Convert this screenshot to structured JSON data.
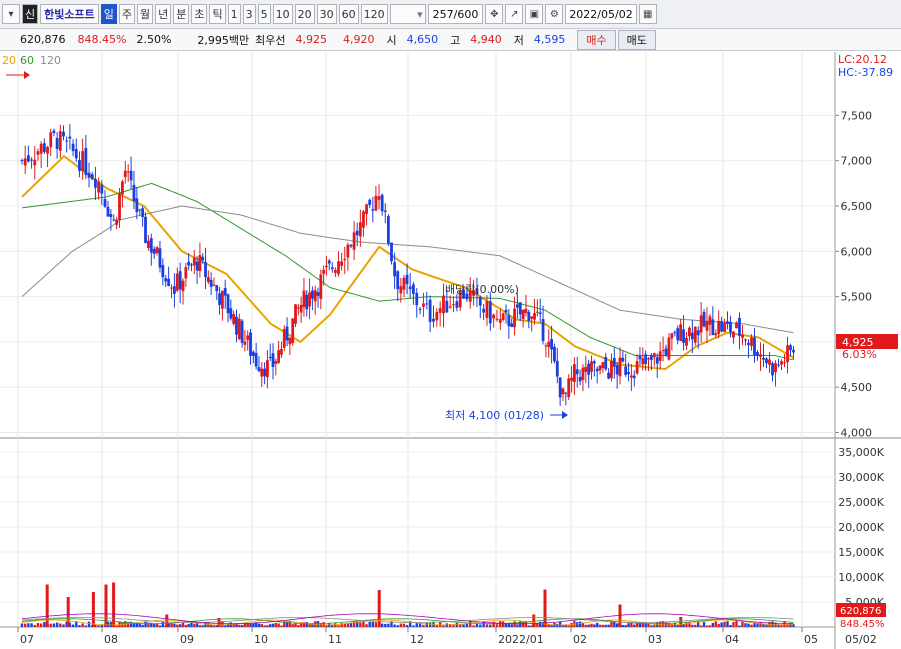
{
  "toolbar": {
    "market_badge": "신",
    "stock_name": "한빛소프트",
    "periods": [
      "일",
      "주",
      "월",
      "년",
      "분",
      "초",
      "틱"
    ],
    "active_period": "일",
    "intervals": [
      "1",
      "3",
      "5",
      "10",
      "20",
      "30",
      "60",
      "120"
    ],
    "count": "257",
    "count_max": "/600",
    "date": "2022/05/02"
  },
  "quote": {
    "price": "620,876",
    "change_pct": "848.45%",
    "rate": "2.50%",
    "amount": "2,995백만",
    "best_ask_label": "최우선",
    "best_ask": "4,925",
    "best_bid": "4,920",
    "open_label": "시",
    "open": "4,650",
    "high_label": "고",
    "high": "4,940",
    "low_label": "저",
    "low": "4,595",
    "buy_label": "매수",
    "sell_label": "매도"
  },
  "chart_labels": {
    "ma_legend": [
      "20",
      "60",
      "120"
    ],
    "lc": "LC:20.12",
    "hc": "HC:-37.89",
    "current_price": "4,925",
    "current_pct": "6.03%",
    "volume_current": "620,876",
    "volume_pct": "848.45%",
    "low_annotation": "최저 4,100 (01/28)",
    "dividend_annotation": "배당락(0.00%)",
    "price_ticks": [
      "7,500",
      "7,000",
      "6,500",
      "6,000",
      "5,500",
      "5,000",
      "4,500",
      "4,000"
    ],
    "volume_ticks": [
      "35,000K",
      "30,000K",
      "25,000K",
      "20,000K",
      "15,000K",
      "10,000K",
      "5,000K"
    ],
    "x_ticks": [
      "07",
      "08",
      "09",
      "10",
      "11",
      "12",
      "2022/01",
      "02",
      "03",
      "04",
      "05",
      "05/02"
    ]
  },
  "chart_data": {
    "type": "line",
    "price_axis": {
      "min": 3950,
      "max": 8200,
      "ticks": [
        4000,
        4500,
        5000,
        5500,
        6000,
        6500,
        7000,
        7500
      ]
    },
    "volume_axis": {
      "min": 0,
      "max": 37000,
      "unit": "K",
      "ticks": [
        5000,
        10000,
        15000,
        20000,
        25000,
        30000,
        35000
      ]
    },
    "months": [
      "07",
      "08",
      "09",
      "10",
      "11",
      "12",
      "2022/01",
      "02",
      "03",
      "04",
      "05"
    ],
    "close_path": [
      {
        "x": 0,
        "y": 7000
      },
      {
        "x": 0.4,
        "y": 7250
      },
      {
        "x": 0.6,
        "y": 7100
      },
      {
        "x": 0.9,
        "y": 6800
      },
      {
        "x": 1.1,
        "y": 6300
      },
      {
        "x": 1.25,
        "y": 6900
      },
      {
        "x": 1.5,
        "y": 6200
      },
      {
        "x": 1.9,
        "y": 5600
      },
      {
        "x": 2.2,
        "y": 5900
      },
      {
        "x": 2.6,
        "y": 5400
      },
      {
        "x": 3.0,
        "y": 4800
      },
      {
        "x": 3.2,
        "y": 4700
      },
      {
        "x": 3.6,
        "y": 5400
      },
      {
        "x": 4.0,
        "y": 5800
      },
      {
        "x": 4.4,
        "y": 6300
      },
      {
        "x": 4.6,
        "y": 6700
      },
      {
        "x": 4.8,
        "y": 5700
      },
      {
        "x": 5.2,
        "y": 5300
      },
      {
        "x": 5.6,
        "y": 5550
      },
      {
        "x": 6.0,
        "y": 5200
      },
      {
        "x": 6.4,
        "y": 5350
      },
      {
        "x": 6.6,
        "y": 5100
      },
      {
        "x": 6.85,
        "y": 4350
      },
      {
        "x": 7.0,
        "y": 4650
      },
      {
        "x": 7.5,
        "y": 4700
      },
      {
        "x": 8.0,
        "y": 4750
      },
      {
        "x": 8.4,
        "y": 5100
      },
      {
        "x": 8.8,
        "y": 5200
      },
      {
        "x": 9.2,
        "y": 5100
      },
      {
        "x": 9.6,
        "y": 4700
      },
      {
        "x": 9.85,
        "y": 4925
      }
    ],
    "series": [
      {
        "name": "20",
        "color": "#e8a300",
        "points": [
          {
            "x": 0,
            "y": 6600
          },
          {
            "x": 0.5,
            "y": 7050
          },
          {
            "x": 1.0,
            "y": 6700
          },
          {
            "x": 1.5,
            "y": 6500
          },
          {
            "x": 2.0,
            "y": 6000
          },
          {
            "x": 2.6,
            "y": 5750
          },
          {
            "x": 3.2,
            "y": 5200
          },
          {
            "x": 3.6,
            "y": 5000
          },
          {
            "x": 4.0,
            "y": 5300
          },
          {
            "x": 4.6,
            "y": 6050
          },
          {
            "x": 5.0,
            "y": 5800
          },
          {
            "x": 5.6,
            "y": 5600
          },
          {
            "x": 6.2,
            "y": 5250
          },
          {
            "x": 6.6,
            "y": 5200
          },
          {
            "x": 7.0,
            "y": 4950
          },
          {
            "x": 7.6,
            "y": 4750
          },
          {
            "x": 8.2,
            "y": 4700
          },
          {
            "x": 8.6,
            "y": 4950
          },
          {
            "x": 9.0,
            "y": 5100
          },
          {
            "x": 9.4,
            "y": 5050
          },
          {
            "x": 9.85,
            "y": 4820
          }
        ]
      },
      {
        "name": "60",
        "color": "#2e9a2e",
        "points": [
          {
            "x": 0,
            "y": 6480
          },
          {
            "x": 1.0,
            "y": 6600
          },
          {
            "x": 1.6,
            "y": 6750
          },
          {
            "x": 2.2,
            "y": 6550
          },
          {
            "x": 2.8,
            "y": 6250
          },
          {
            "x": 3.4,
            "y": 5950
          },
          {
            "x": 4.0,
            "y": 5600
          },
          {
            "x": 4.6,
            "y": 5450
          },
          {
            "x": 5.2,
            "y": 5500
          },
          {
            "x": 6.0,
            "y": 5480
          },
          {
            "x": 6.6,
            "y": 5350
          },
          {
            "x": 7.2,
            "y": 5050
          },
          {
            "x": 7.8,
            "y": 4850
          },
          {
            "x": 8.4,
            "y": 4850
          },
          {
            "x": 9.0,
            "y": 4850
          },
          {
            "x": 9.6,
            "y": 4850
          },
          {
            "x": 9.85,
            "y": 4800
          }
        ]
      },
      {
        "name": "120",
        "color": "#8b8b8b",
        "points": [
          {
            "x": 0,
            "y": 5500
          },
          {
            "x": 0.6,
            "y": 6000
          },
          {
            "x": 1.2,
            "y": 6350
          },
          {
            "x": 2.0,
            "y": 6500
          },
          {
            "x": 2.8,
            "y": 6400
          },
          {
            "x": 3.6,
            "y": 6200
          },
          {
            "x": 4.4,
            "y": 6100
          },
          {
            "x": 5.2,
            "y": 6050
          },
          {
            "x": 6.0,
            "y": 5950
          },
          {
            "x": 6.8,
            "y": 5650
          },
          {
            "x": 7.6,
            "y": 5350
          },
          {
            "x": 8.4,
            "y": 5250
          },
          {
            "x": 9.2,
            "y": 5200
          },
          {
            "x": 9.85,
            "y": 5100
          }
        ]
      }
    ],
    "volume_spikes": [
      {
        "x": 0.3,
        "v": 8500
      },
      {
        "x": 0.55,
        "v": 6000
      },
      {
        "x": 0.85,
        "v": 7000
      },
      {
        "x": 1.0,
        "v": 8500
      },
      {
        "x": 1.1,
        "v": 8900
      },
      {
        "x": 1.8,
        "v": 2500
      },
      {
        "x": 2.5,
        "v": 1800
      },
      {
        "x": 4.6,
        "v": 7400
      },
      {
        "x": 6.45,
        "v": 2500
      },
      {
        "x": 6.6,
        "v": 7500
      },
      {
        "x": 7.6,
        "v": 4500
      },
      {
        "x": 8.4,
        "v": 2000
      }
    ],
    "legend_position": "top-left",
    "grid": true
  }
}
